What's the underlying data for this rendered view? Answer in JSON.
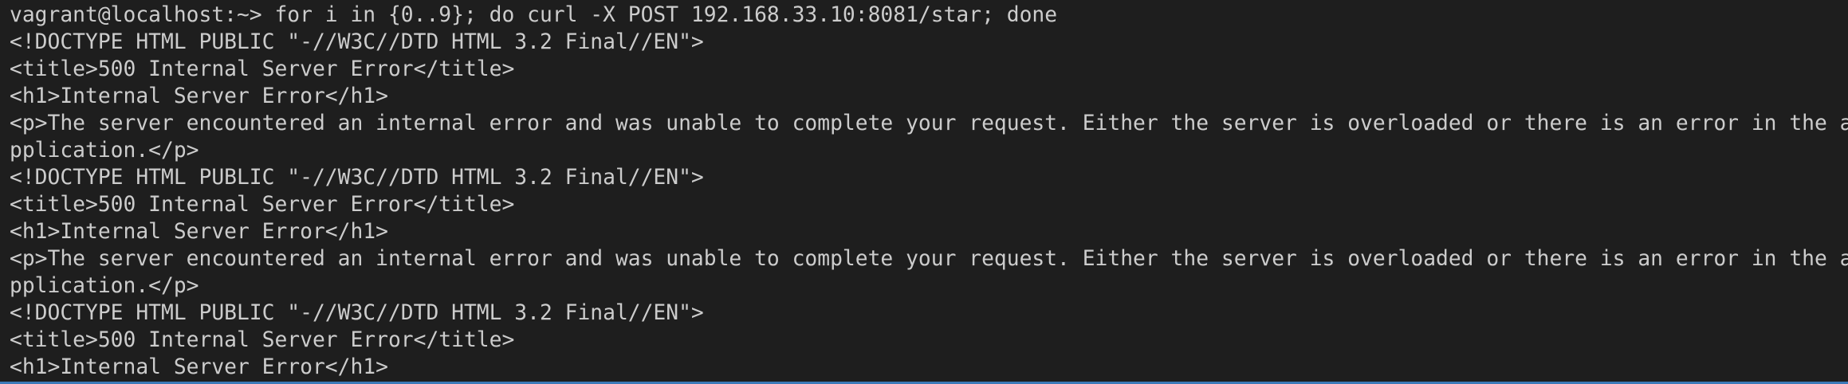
{
  "terminal": {
    "lines": [
      "vagrant@localhost:~> for i in {0..9}; do curl -X POST 192.168.33.10:8081/star; done",
      "<!DOCTYPE HTML PUBLIC \"-//W3C//DTD HTML 3.2 Final//EN\">",
      "<title>500 Internal Server Error</title>",
      "<h1>Internal Server Error</h1>",
      "<p>The server encountered an internal error and was unable to complete your request. Either the server is overloaded or there is an error in the a",
      "pplication.</p>",
      "<!DOCTYPE HTML PUBLIC \"-//W3C//DTD HTML 3.2 Final//EN\">",
      "<title>500 Internal Server Error</title>",
      "<h1>Internal Server Error</h1>",
      "<p>The server encountered an internal error and was unable to complete your request. Either the server is overloaded or there is an error in the a",
      "pplication.</p>",
      "<!DOCTYPE HTML PUBLIC \"-//W3C//DTD HTML 3.2 Final//EN\">",
      "<title>500 Internal Server Error</title>",
      "<h1>Internal Server Error</h1>"
    ]
  },
  "colors": {
    "background": "#1e1e1e",
    "text": "#cccccc",
    "focus_border": "#3c7ab8"
  }
}
